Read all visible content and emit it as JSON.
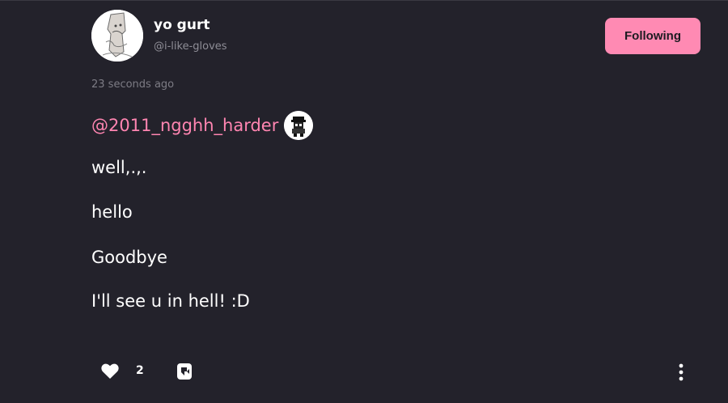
{
  "author": {
    "name": "yo gurt",
    "handle": "@i-like-gloves",
    "avatar_icon": "sketch-avatar-icon"
  },
  "follow_button": {
    "label": "Following",
    "color": "#ff8ab3"
  },
  "post": {
    "timestamp": "23 seconds ago",
    "mention": "@2011_ngghh_harder",
    "mention_avatar_icon": "pixel-character-avatar-icon",
    "lines": [
      "well,.,.",
      "hello",
      "Goodbye",
      "I'll see u in hell! :D"
    ]
  },
  "actions": {
    "like_icon": "heart-icon",
    "like_count": "2",
    "reblog_icon": "reblog-icon",
    "more_icon": "more-vertical-icon"
  },
  "colors": {
    "background": "#23222b",
    "accent": "#ff85b1",
    "muted_text": "#8e8d96"
  }
}
